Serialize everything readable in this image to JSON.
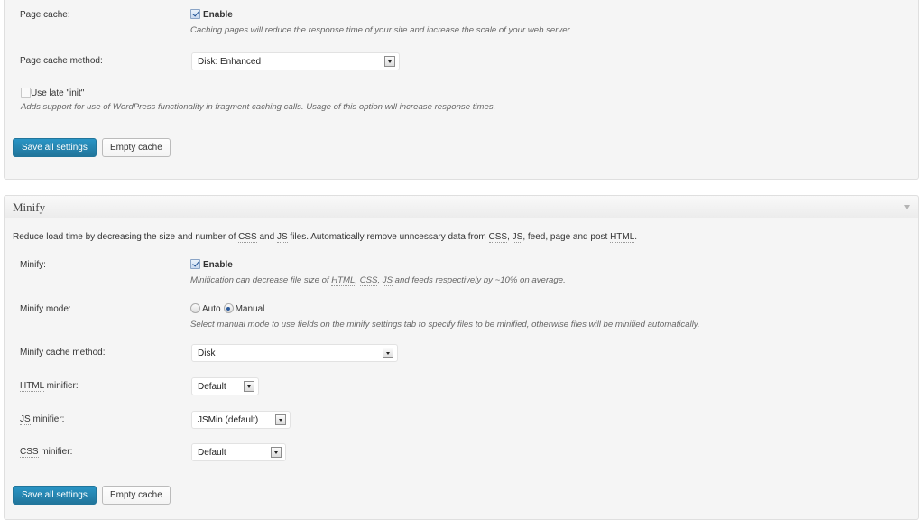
{
  "page_cache_section": {
    "page_cache": {
      "label": "Page cache:",
      "checkbox_label": "Enable",
      "checked": true,
      "description": "Caching pages will reduce the response time of your site and increase the scale of your web server."
    },
    "page_cache_method": {
      "label": "Page cache method:",
      "selected": "Disk: Enhanced"
    },
    "late_init": {
      "checkbox_label": "Use late \"init\"",
      "checked": false,
      "description": "Adds support for use of WordPress functionality in fragment caching calls. Usage of this option will increase response times."
    },
    "buttons": {
      "save": "Save all settings",
      "empty": "Empty cache"
    }
  },
  "minify_section": {
    "title": "Minify",
    "intro": {
      "part1": "Reduce load time by decreasing the size and number of ",
      "abbr_css": "CSS",
      "part2": " and ",
      "abbr_js": "JS",
      "part3": " files. Automatically remove unncessary data from ",
      "abbr_css2": "CSS",
      "part4": ", ",
      "abbr_js2": "JS",
      "part5": ", feed, page and post ",
      "abbr_html": "HTML",
      "part6": "."
    },
    "minify": {
      "label": "Minify:",
      "checkbox_label": "Enable",
      "checked": true,
      "desc_part1": "Minification can decrease file size of ",
      "desc_html": "HTML",
      "desc_sep1": ", ",
      "desc_css": "CSS",
      "desc_sep2": ", ",
      "desc_js": "JS",
      "desc_part2": " and feeds respectively by ~10% on average."
    },
    "minify_mode": {
      "label": "Minify mode:",
      "options": [
        "Auto",
        "Manual"
      ],
      "selected": "Manual",
      "description": "Select manual mode to use fields on the minify settings tab to specify files to be minified, otherwise files will be minified automatically."
    },
    "minify_cache_method": {
      "label": "Minify cache method:",
      "selected": "Disk"
    },
    "html_minifier": {
      "label_abbr": "HTML",
      "label_rest": " minifier:",
      "selected": "Default"
    },
    "js_minifier": {
      "label_abbr": "JS",
      "label_rest": " minifier:",
      "selected": "JSMin (default)"
    },
    "css_minifier": {
      "label_abbr": "CSS",
      "label_rest": " minifier:",
      "selected": "Default"
    },
    "buttons": {
      "save": "Save all settings",
      "empty": "Empty cache"
    }
  },
  "colors": {
    "primary_button": "#21759b",
    "panel_background": "#f5f5f5"
  }
}
